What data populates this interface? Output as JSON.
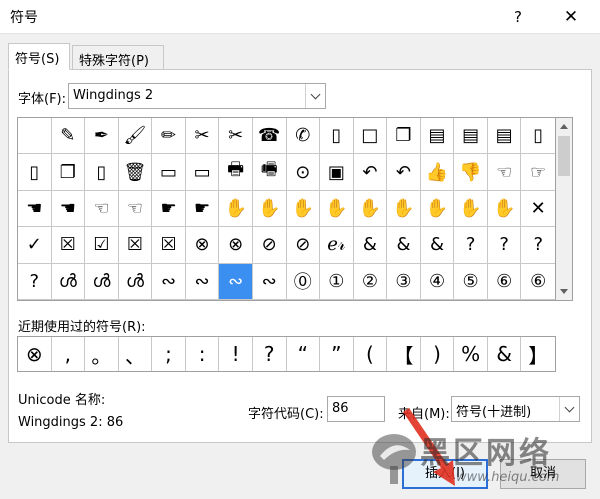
{
  "window": {
    "title": "符号",
    "help": "?",
    "close": "✕"
  },
  "tabs": [
    {
      "label": "符号(S)",
      "active": true
    },
    {
      "label": "特殊字符(P)",
      "active": false
    }
  ],
  "font": {
    "label": "字体(F):",
    "value": "Wingdings 2"
  },
  "grid": {
    "selected_index": 70,
    "rows": [
      [
        "",
        "✎",
        "✒",
        "🖌",
        "✏",
        "✂",
        "✂",
        "☎",
        "✆",
        "▯",
        "□",
        "❐",
        "▤",
        "▤",
        "▤",
        "▯"
      ],
      [
        "▯",
        "❐",
        "▯",
        "🗑",
        "▭",
        "▭",
        "🖶",
        "🖷",
        "⊙",
        "▣",
        "↶",
        "↶",
        "👍",
        "👎",
        "☜",
        "☞"
      ],
      [
        "☚",
        "☚",
        "☜",
        "☜",
        "☛",
        "☛",
        "✋",
        "✋",
        "✋",
        "✋",
        "✋",
        "✋",
        "✋",
        "✋",
        "✋",
        "✕"
      ],
      [
        "✓",
        "☒",
        "☑",
        "☒",
        "☒",
        "⊗",
        "⊗",
        "⊘",
        "⊘",
        "ℯ𝓇",
        "&",
        "&",
        "&",
        "?",
        "?",
        "?"
      ],
      [
        "?",
        "ൾ",
        "ൾ",
        "ൾ",
        "∾",
        "∾",
        "∾",
        "∾",
        "⓪",
        "①",
        "②",
        "③",
        "④",
        "⑤",
        "⑥",
        "⑥"
      ]
    ]
  },
  "recent": {
    "label": "近期使用过的符号(R):",
    "items": [
      "⊗",
      ",",
      "。",
      "、",
      ";",
      ":",
      "!",
      "?",
      "“",
      "”",
      "(",
      "【",
      ")",
      "%",
      "&",
      "】"
    ]
  },
  "unicode": {
    "label": "Unicode 名称:",
    "value": "Wingdings 2: 86"
  },
  "char_code": {
    "label": "字符代码(C):",
    "value": "86"
  },
  "from": {
    "label": "来自(M):",
    "value": "符号(十进制)"
  },
  "buttons": {
    "insert": "插入(I)",
    "cancel": "取消"
  },
  "watermark": {
    "text": "黑区网络",
    "url": "www.heiqu.com"
  },
  "colors": {
    "accent": "#3b8ff0",
    "arrow": "#e03020"
  }
}
